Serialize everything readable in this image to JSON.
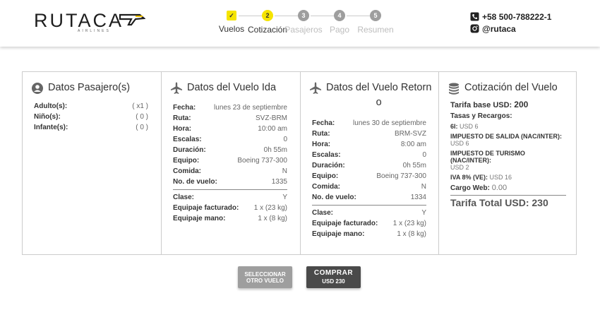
{
  "brand": {
    "name": "RUTACA",
    "tagline": "AIRLINES"
  },
  "stepper": [
    {
      "num": "✓",
      "label": "Vuelos",
      "state": "done"
    },
    {
      "num": "2",
      "label": "Cotización",
      "state": "active"
    },
    {
      "num": "3",
      "label": "Pasajeros",
      "state": "todo"
    },
    {
      "num": "4",
      "label": "Pago",
      "state": "todo"
    },
    {
      "num": "5",
      "label": "Resumen",
      "state": "todo"
    }
  ],
  "contact": {
    "phone": "+58 500-788222-1",
    "instagram": "@rutaca"
  },
  "passengers": {
    "title": "Datos Pasajero(s)",
    "rows": [
      {
        "k": "Adulto(s):",
        "v": "( x1 )"
      },
      {
        "k": "Niño(s):",
        "v": "( 0 )"
      },
      {
        "k": "Infante(s):",
        "v": "( 0 )"
      }
    ]
  },
  "outbound": {
    "title": "Datos del Vuelo Ida",
    "rows": [
      {
        "k": "Fecha:",
        "v": "lunes 23 de septiembre"
      },
      {
        "k": "Ruta:",
        "v": "SVZ-BRM"
      },
      {
        "k": "Hora:",
        "v": "10:00 am"
      },
      {
        "k": "Escalas:",
        "v": "0"
      },
      {
        "k": "Duración:",
        "v": "0h 55m"
      },
      {
        "k": "Equipo:",
        "v": "Boeing 737-300"
      },
      {
        "k": "Comida:",
        "v": "N"
      },
      {
        "k": "No. de vuelo:",
        "v": "1335"
      }
    ],
    "rows2": [
      {
        "k": "Clase:",
        "v": "Y"
      },
      {
        "k": "Equipaje facturado:",
        "v": "1 x (23 kg)"
      },
      {
        "k": "Equipaje mano:",
        "v": "1 x (8 kg)"
      }
    ]
  },
  "return": {
    "title_a": "Datos del Vuelo Retorn",
    "title_b": "o",
    "rows": [
      {
        "k": "Fecha:",
        "v": "lunes 30 de septiembre"
      },
      {
        "k": "Ruta:",
        "v": "BRM-SVZ"
      },
      {
        "k": "Hora:",
        "v": "8:00 am"
      },
      {
        "k": "Escalas:",
        "v": "0"
      },
      {
        "k": "Duración:",
        "v": "0h 55m"
      },
      {
        "k": "Equipo:",
        "v": "Boeing 737-300"
      },
      {
        "k": "Comida:",
        "v": "N"
      },
      {
        "k": "No. de vuelo:",
        "v": "1334"
      }
    ],
    "rows2": [
      {
        "k": "Clase:",
        "v": "Y"
      },
      {
        "k": "Equipaje facturado:",
        "v": "1 x (23 kg)"
      },
      {
        "k": "Equipaje mano:",
        "v": "1 x (8 kg)"
      }
    ]
  },
  "quote": {
    "title": "Cotización del Vuelo",
    "base_label": "Tarifa base USD:",
    "base_value": "200",
    "taxes_label": "Tasas y Recargos:",
    "t1_label": "6I:",
    "t1_value": "USD 6",
    "t2_label": "IMPUESTO DE SALIDA (NAC/INTER):",
    "t2_value": "USD 6",
    "t3_label": "IMPUESTO DE TURISMO (NAC/INTER):",
    "t3_value": "USD 2",
    "t4_label": "IVA 8% (VE):",
    "t4_value": "USD 16",
    "web_label": "Cargo Web:",
    "web_value": "0.00",
    "total": "Tarifa Total USD: 230"
  },
  "buttons": {
    "other_line1": "SELECCIONAR",
    "other_line2": "OTRO VUELO",
    "buy_line1": "COMPRAR",
    "buy_line2": "USD 230"
  },
  "colors": {
    "accent": "#f5e400",
    "buy_button": "#4a4a4a",
    "other_button": "#9e9e9e"
  }
}
